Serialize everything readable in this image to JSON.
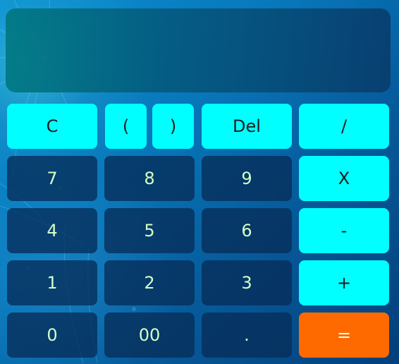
{
  "display": {
    "value": ""
  },
  "keys": {
    "clear": "C",
    "open_paren": "(",
    "close_paren": ")",
    "delete": "Del",
    "divide": "/",
    "seven": "7",
    "eight": "8",
    "nine": "9",
    "multiply": "X",
    "four": "4",
    "five": "5",
    "six": "6",
    "minus": "-",
    "one": "1",
    "two": "2",
    "three": "3",
    "plus": "+",
    "zero": "0",
    "double_zero": "00",
    "decimal": ".",
    "equals": "="
  },
  "colors": {
    "operator_key": "#00ffff",
    "digit_key": "#072d58",
    "equals_key": "#ff6a00",
    "digit_text": "#d4ffc7",
    "background_light": "#0a8fd2",
    "background_dark": "#043f7a"
  }
}
